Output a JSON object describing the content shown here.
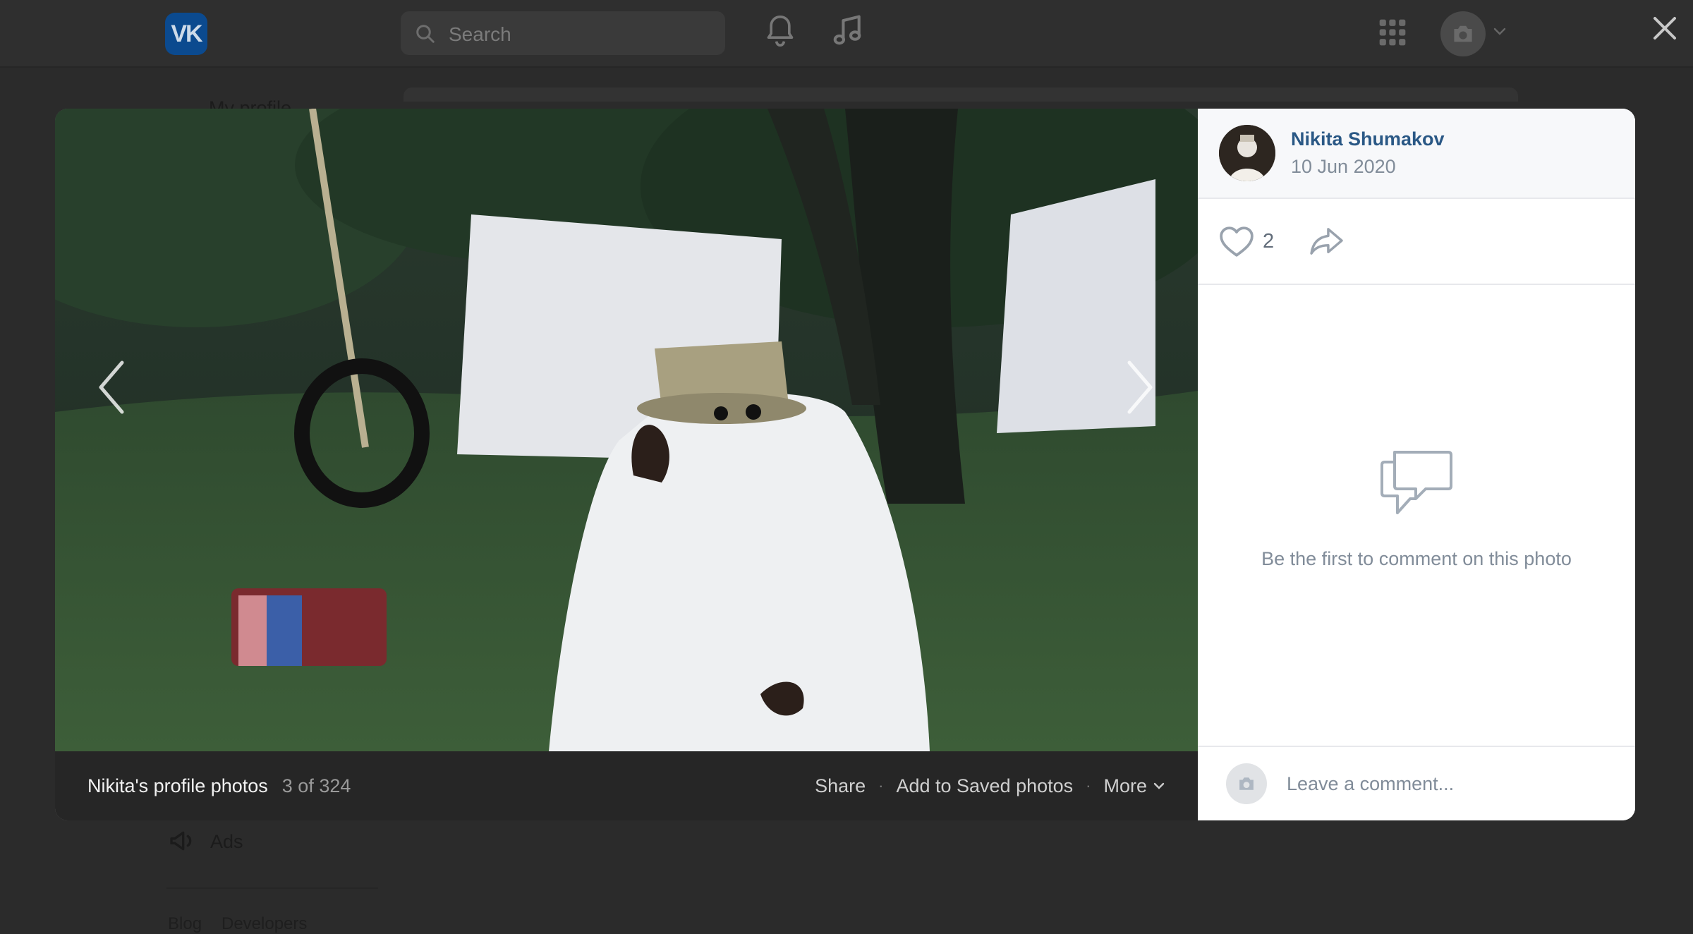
{
  "header": {
    "logo_text": "VK",
    "search_placeholder": "Search"
  },
  "background_page": {
    "sidebar_first_item": "My profile",
    "sidebar_ads": "Ads",
    "footer_links": [
      "Blog",
      "Developers"
    ]
  },
  "viewer": {
    "album_title": "Nikita's profile photos",
    "counter": "3 of 324",
    "actions": {
      "share": "Share",
      "save": "Add to Saved photos",
      "more": "More"
    }
  },
  "side_panel": {
    "author_name": "Nikita Shumakov",
    "date": "10 Jun 2020",
    "likes": "2",
    "empty_comments_text": "Be the first to comment on this photo",
    "comment_placeholder": "Leave a comment..."
  },
  "colors": {
    "link": "#2a5885",
    "muted": "#818c99",
    "overlay_bg": "#2b2b2b",
    "footer_bg": "#262626"
  }
}
